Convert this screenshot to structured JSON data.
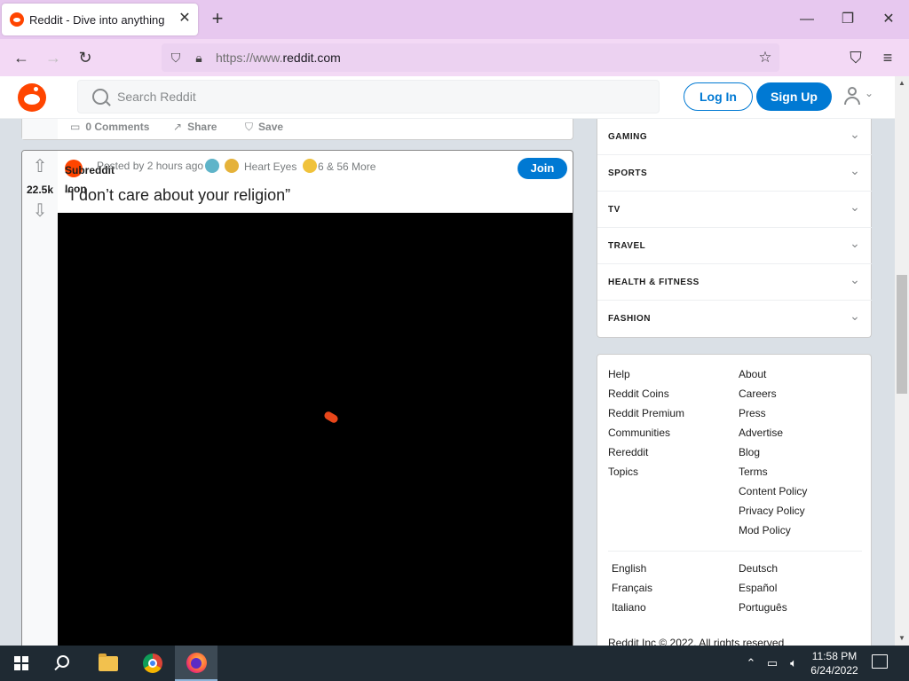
{
  "browser": {
    "tab_title": "Reddit - Dive into anything",
    "url_prefix": "https://www.",
    "url_domain": "reddit.com"
  },
  "header": {
    "search_placeholder": "Search Reddit",
    "login_label": "Log In",
    "signup_label": "Sign Up",
    "brand_color": "#ff4500",
    "accent_color": "#0079d3"
  },
  "prev_post": {
    "comments_label": "0 Comments",
    "share_label": "Share",
    "save_label": "Save"
  },
  "post": {
    "vote_count": "22.5k",
    "subreddit_icon_alt": "Subreddit Icon",
    "posted_by": "Posted by 2 hours ago",
    "award_label": "Heart Eyes",
    "award_more": "6 & 56 More",
    "join_label": "Join",
    "title": "“I don’t care about your religion”"
  },
  "sidebar": {
    "topics": [
      "GAMING",
      "SPORTS",
      "TV",
      "TRAVEL",
      "HEALTH & FITNESS",
      "FASHION"
    ],
    "footer_links_left": [
      "Help",
      "Reddit Coins",
      "Reddit Premium",
      "Communities",
      "Rereddit",
      "Topics"
    ],
    "footer_links_right": [
      "About",
      "Careers",
      "Press",
      "Advertise",
      "Blog",
      "Terms",
      "Content Policy",
      "Privacy Policy",
      "Mod Policy"
    ],
    "languages_left": [
      "English",
      "Français",
      "Italiano"
    ],
    "languages_right": [
      "Deutsch",
      "Español",
      "Português"
    ],
    "copyright": "Reddit Inc © 2022. All rights reserved"
  },
  "taskbar": {
    "time": "11:58 PM",
    "date": "6/24/2022"
  }
}
